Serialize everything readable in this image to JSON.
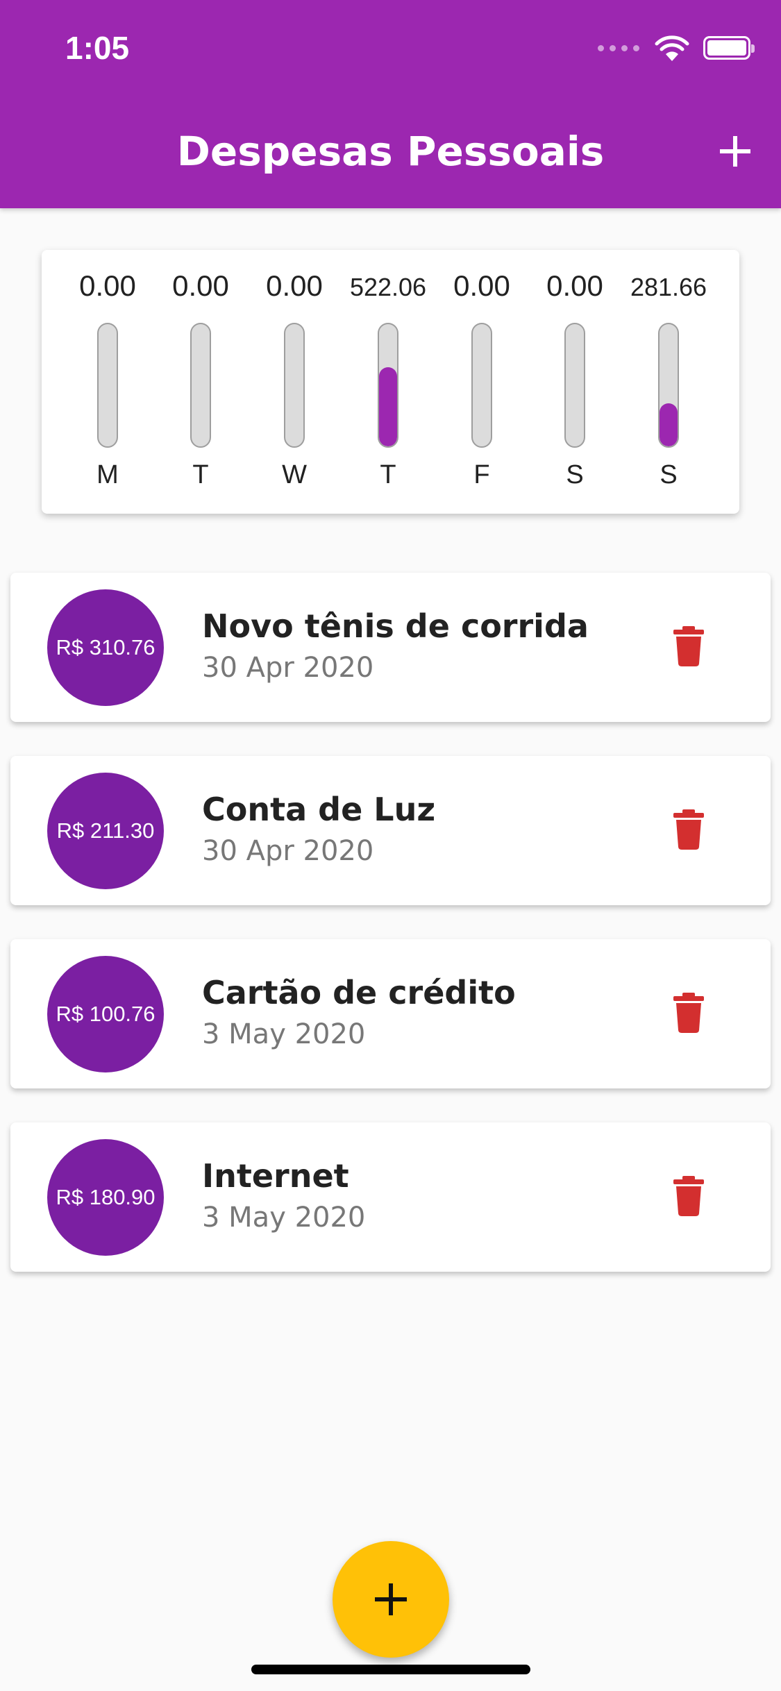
{
  "status_bar": {
    "time": "1:05"
  },
  "app_bar": {
    "title": "Despesas Pessoais",
    "add_icon": "plus-icon"
  },
  "chart": {
    "max_total": 803.72,
    "days": [
      {
        "day": "M",
        "value_label": "0.00",
        "value": 0.0
      },
      {
        "day": "T",
        "value_label": "0.00",
        "value": 0.0
      },
      {
        "day": "W",
        "value_label": "0.00",
        "value": 0.0
      },
      {
        "day": "T",
        "value_label": "522.06",
        "value": 522.06
      },
      {
        "day": "F",
        "value_label": "0.00",
        "value": 0.0
      },
      {
        "day": "S",
        "value_label": "0.00",
        "value": 0.0
      },
      {
        "day": "S",
        "value_label": "281.66",
        "value": 281.66
      }
    ]
  },
  "transactions": [
    {
      "amount": "R$ 310.76",
      "title": "Novo tênis de corrida",
      "date": "30 Apr 2020",
      "delete_icon": "trash-icon"
    },
    {
      "amount": "R$ 211.30",
      "title": "Conta de Luz",
      "date": "30 Apr 2020",
      "delete_icon": "trash-icon"
    },
    {
      "amount": "R$ 100.76",
      "title": "Cartão de crédito",
      "date": "3 May 2020",
      "delete_icon": "trash-icon"
    },
    {
      "amount": "R$ 180.90",
      "title": "Internet",
      "date": "3 May 2020",
      "delete_icon": "trash-icon"
    }
  ],
  "fab": {
    "icon": "plus-icon"
  },
  "colors": {
    "primary": "#9c27b0",
    "avatar": "#7b1fa2",
    "accent": "#ffc107",
    "delete": "#d32f2f",
    "bar_track": "#dcdcdc"
  }
}
